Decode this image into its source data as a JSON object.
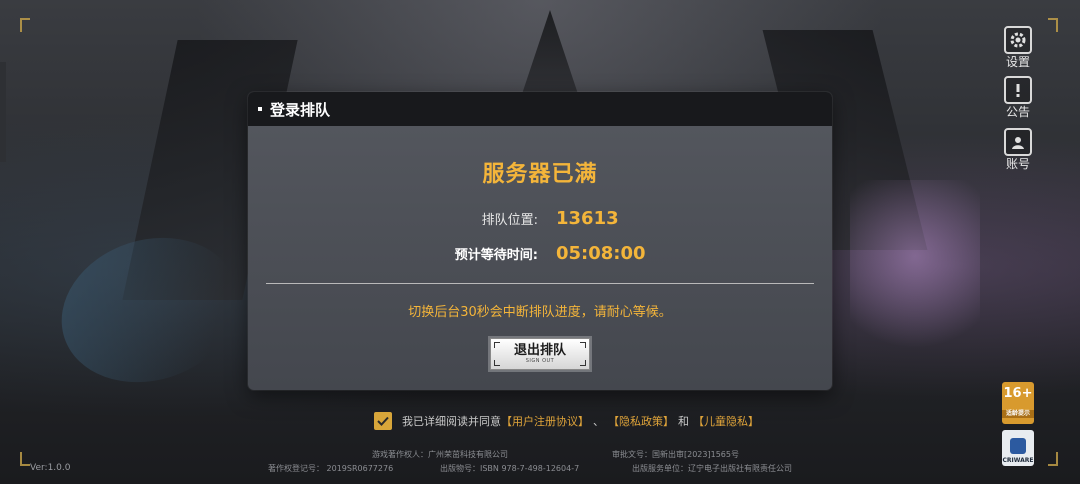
{
  "dialog": {
    "header": "登录排队",
    "title": "服务器已满",
    "queue_label": "排队位置:",
    "queue_value": "13613",
    "wait_label": "预计等待时间:",
    "wait_value": "05:08:00",
    "notice": "切换后台30秒会中断排队进度，请耐心等候。",
    "exit_button": "退出排队",
    "exit_button_sub": "SIGN OUT"
  },
  "side_menu": [
    {
      "label": "设置",
      "icon": "gear-icon"
    },
    {
      "label": "公告",
      "icon": "notice-icon"
    },
    {
      "label": "账号",
      "icon": "account-icon"
    }
  ],
  "agreement": {
    "prefix": "我已详细阅读并同意",
    "user_agreement": "【用户注册协议】",
    "sep": "、",
    "privacy": "【隐私政策】",
    "and": "和",
    "child_privacy": "【儿童隐私】",
    "checked": true
  },
  "footer": {
    "copyright_owner": "游戏著作权人：广州荣茁科技有限公司",
    "approval_no": "审批文号：国新出审[2023]1565号",
    "reg_no": "著作权登记号： 2019SR0677276",
    "isbn": "出版物号：ISBN 978-7-498-12604-7",
    "publisher": "出版服务单位：辽宁电子出版社有限责任公司",
    "version": "Ver:1.0.0"
  },
  "badges": {
    "age_rating": "16+",
    "age_tip": "适龄提示",
    "middleware": "CRIWARE"
  },
  "colors": {
    "accent": "#f4b53a",
    "header_bg": "#18191c",
    "dialog_bg": "#4c4f56"
  }
}
